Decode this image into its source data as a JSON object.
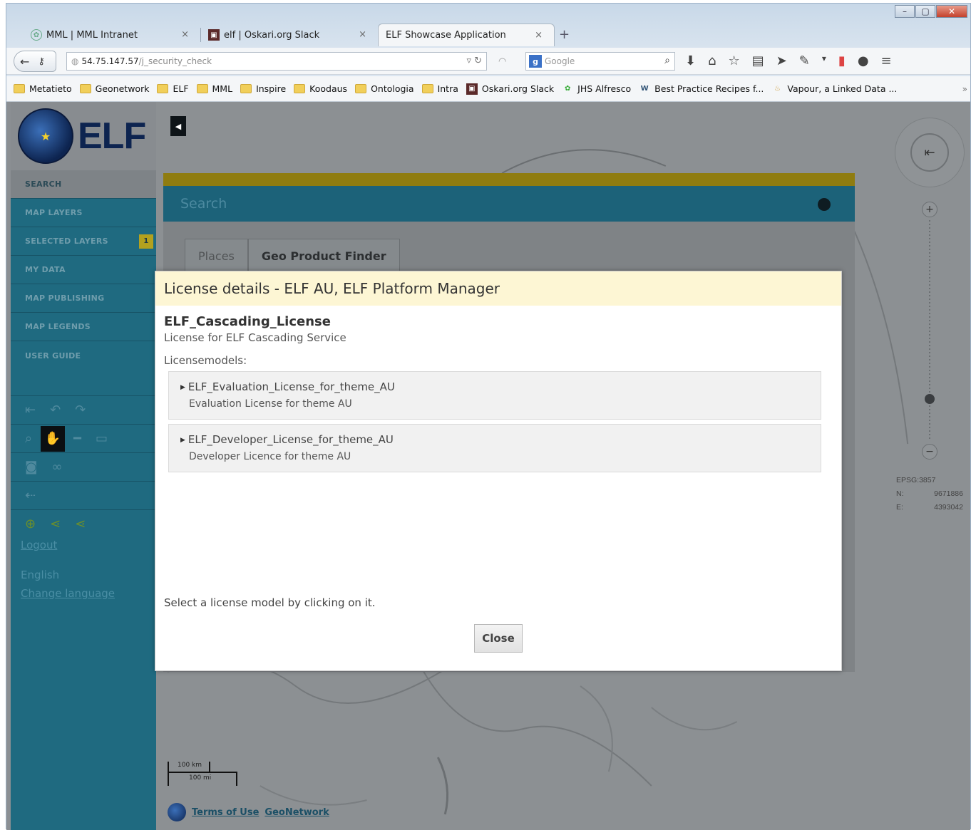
{
  "browser": {
    "tabs": [
      {
        "label": "MML | MML Intranet",
        "icon": "intranet-favicon",
        "active": false
      },
      {
        "label": "elf | Oskari.org Slack",
        "icon": "slack-favicon",
        "active": false
      },
      {
        "label": "ELF Showcase Application",
        "icon": "none",
        "active": true
      }
    ],
    "url": {
      "host": "54.75.147.57",
      "path": "/j_security_check"
    },
    "search_placeholder": "Google",
    "bookmarks": [
      {
        "label": "Metatieto",
        "icon": "folder"
      },
      {
        "label": "Geonetwork",
        "icon": "folder"
      },
      {
        "label": "ELF",
        "icon": "folder"
      },
      {
        "label": "MML",
        "icon": "folder"
      },
      {
        "label": "Inspire",
        "icon": "folder"
      },
      {
        "label": "Koodaus",
        "icon": "folder"
      },
      {
        "label": "Ontologia",
        "icon": "folder"
      },
      {
        "label": "Intra",
        "icon": "folder"
      },
      {
        "label": "Oskari.org Slack",
        "icon": "slack-favicon"
      },
      {
        "label": "JHS Alfresco",
        "icon": "alfresco-favicon"
      },
      {
        "label": "Best Practice Recipes f...",
        "icon": "ws-favicon"
      },
      {
        "label": "Vapour, a Linked Data ...",
        "icon": "vapour-favicon"
      }
    ]
  },
  "app": {
    "logo_text": "ELF",
    "menu": [
      {
        "label": "SEARCH",
        "active": true
      },
      {
        "label": "MAP LAYERS",
        "active": false
      },
      {
        "label": "SELECTED LAYERS",
        "active": false,
        "badge": "1"
      },
      {
        "label": "MY DATA",
        "active": false
      },
      {
        "label": "MAP PUBLISHING",
        "active": false
      },
      {
        "label": "MAP LEGENDS",
        "active": false
      },
      {
        "label": "USER GUIDE",
        "active": false
      }
    ],
    "logout": "Logout",
    "language": "English",
    "change_language": "Change language"
  },
  "search_panel": {
    "title": "Search",
    "tabs": [
      "Places",
      "Geo Product Finder"
    ]
  },
  "map": {
    "crs": "EPSG:3857",
    "north_label": "N:",
    "north_value": "9671886",
    "east_label": "E:",
    "east_value": "4393042",
    "scale_km": "100 km",
    "scale_mi": "100 mi",
    "footer_links": [
      "Terms of Use",
      "GeoNetwork"
    ]
  },
  "modal": {
    "title": "License details - ELF AU, ELF Platform Manager",
    "license_name": "ELF_Cascading_License",
    "license_desc": "License for ELF Cascading Service",
    "models_label": "Licensemodels:",
    "models": [
      {
        "name": "ELF_Evaluation_License_for_theme_AU",
        "desc": "Evaluation License for theme AU"
      },
      {
        "name": "ELF_Developer_License_for_theme_AU",
        "desc": "Developer Licence for theme AU"
      }
    ],
    "hint": "Select a license model by clicking on it.",
    "close_label": "Close"
  }
}
